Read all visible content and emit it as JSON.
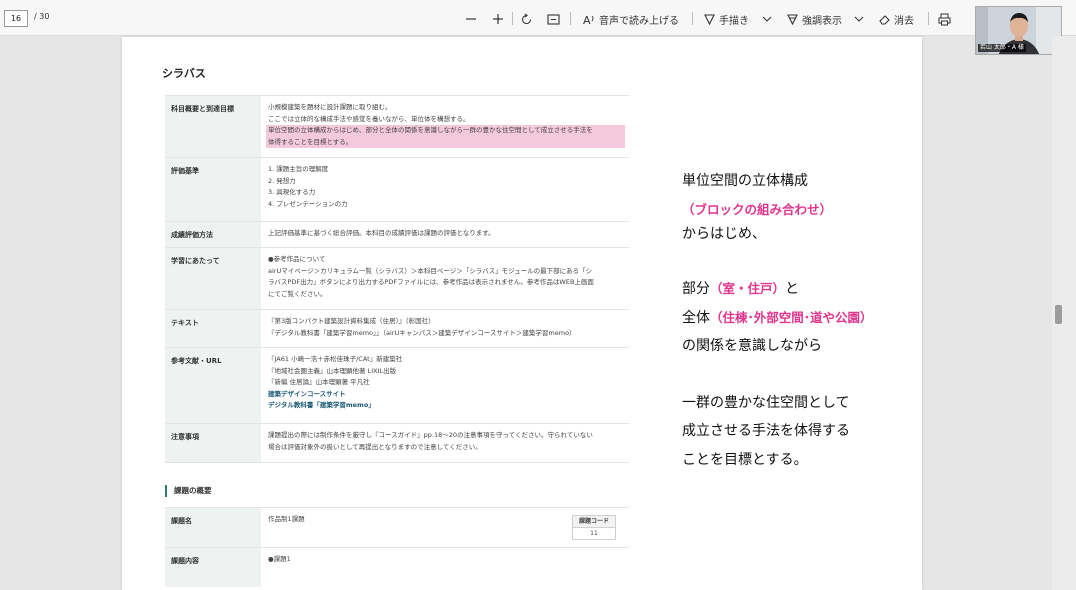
{
  "viewer": {
    "page_current": "16",
    "page_total": "/ 30",
    "read_aloud": "音声で読み上げる",
    "draw": "手描き",
    "highlight": "強調表示",
    "erase": "消去"
  },
  "webcam": {
    "name_tag": "若山 太郎・A 様"
  },
  "doc": {
    "syllabus_title": "シラバス",
    "rows": [
      {
        "label": "科目概要と到達目標",
        "lines": [
          "小規模建築を題材に設計課題に取り組む。",
          "ここでは立体的な構成手法や感覚を養いながら、単位体を構想する。"
        ],
        "highlight": [
          "単位空間の立体構成からはじめ、部分と全体の関係を意識しながら一群の豊かな住空間として成立させる手法を",
          "体得することを目標とする。"
        ]
      },
      {
        "label": "評価基準",
        "lines": [
          "1. 課題主旨の理解度",
          "2. 発想力",
          "3. 具現化する力",
          "4. プレゼンテーションの力"
        ]
      },
      {
        "label": "成績評価方法",
        "lines": [
          "上記評価基準に基づく総合評価。本科目の成績評価は課題の評価となります。"
        ]
      },
      {
        "label": "学習にあたって",
        "lines": [
          "●参考作品について",
          "airUマイページ＞カリキュラム一覧（シラバス）＞本科目ページ＞「シラバス」モジュールの最下部にある「シ",
          "ラバスPDF出力」ボタンにより出力するPDFファイルには、参考作品は表示されません。参考作品はWEB上画面",
          "にてご覧ください。"
        ]
      },
      {
        "label": "テキスト",
        "lines": [
          "『第3版コンパクト建築設計資料集成〈住居〉』（彰国社）",
          "『デジタル教科書「建築学習memo」』（airUキャンパス＞建築デザインコースサイト＞建築学習memo）"
        ]
      },
      {
        "label": "参考文献・URL",
        "lines": [
          "『JA61 小嶋一浩＋赤松佳珠子/CAt』新建築社",
          "『地域社会圏主義』山本理顕他著 LIXIL出版",
          "『新編 住居論』山本理顕著 平凡社"
        ],
        "links": [
          "建築デザインコースサイト",
          "デジタル教科書「建築学習memo」"
        ]
      },
      {
        "label": "注意事項",
        "lines": [
          "課題提出の際には制作条件を厳守し『コースガイド』pp.18～20の注意事項を守ってください。守られていない",
          "場合は評価対象外の扱いとして再提出となりますので注意してください。"
        ]
      }
    ],
    "assignment_section": "課題の概要",
    "assignment_row_label": "課題名",
    "assignment_name": "作品制1課題",
    "code_header": "課題コード",
    "code_value": "11",
    "next_row_label": "課題内容",
    "next_row_text": "●課題1"
  },
  "annotation": {
    "line1": "単位空間の立体構成",
    "line2": "（ブロックの組み合わせ）",
    "line3": "からはじめ、",
    "line4_pre": "部分",
    "line4_pink": "（室・住戸）",
    "line4_post": "と",
    "line5_pre": "全体",
    "line5_pink": "（住棟･外部空間･道や公園）",
    "line6": "の関係を意識しながら",
    "line7": "一群の豊かな住空間として",
    "line8": "成立させる手法を体得する",
    "line9": "ことを目標とする。"
  }
}
